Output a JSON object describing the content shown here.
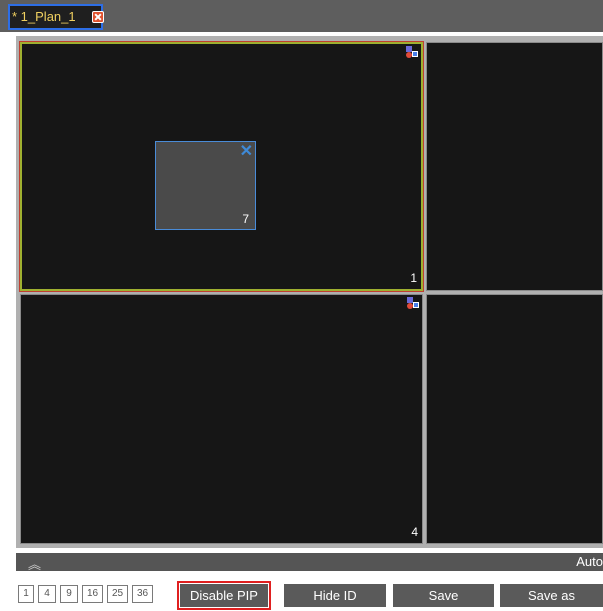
{
  "tab": {
    "title": "* 1_Plan_1",
    "close_icon": "close-icon"
  },
  "cells": [
    {
      "id": "1",
      "icon": "cell-mode-icon"
    },
    {
      "id": "",
      "icon": ""
    },
    {
      "id": "4",
      "icon": "cell-mode-icon"
    },
    {
      "id": "",
      "icon": ""
    }
  ],
  "pip": {
    "id": "7",
    "close_glyph": "✕"
  },
  "collapse_bar": {
    "chevron": "︽",
    "label": "Auto"
  },
  "layout_buttons": [
    "1",
    "4",
    "9",
    "16",
    "25",
    "36"
  ],
  "actions": {
    "disable_pip": "Disable PIP",
    "hide_id": "Hide ID",
    "save": "Save",
    "save_as": "Save as"
  },
  "colors": {
    "tab_border": "#2d6ee6",
    "tab_text": "#f0d060",
    "selected_border": "#9fb030",
    "highlight_outline": "#e02020",
    "pip_border": "#4a8cd8"
  }
}
